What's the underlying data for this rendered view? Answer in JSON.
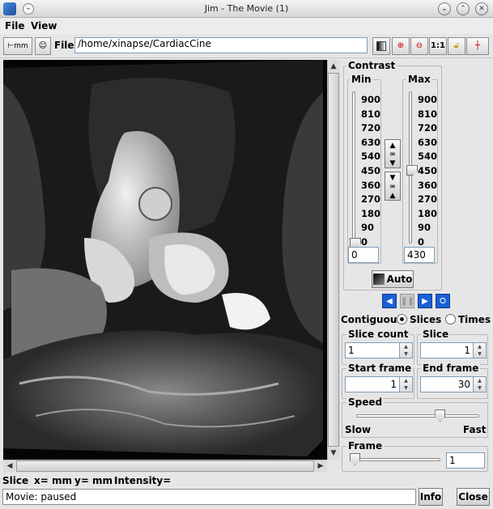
{
  "window": {
    "title": "Jim - The Movie (1)"
  },
  "menu": {
    "file": "File",
    "view": "View"
  },
  "toolbar": {
    "units_label": "mm",
    "file_label": "File:",
    "file_path": "/home/xinapse/CardiacCine",
    "zoom_1to1": "1:1"
  },
  "contrast": {
    "title": "Contrast",
    "min_label": "Min",
    "max_label": "Max",
    "ticks": [
      "900",
      "810",
      "720",
      "630",
      "540",
      "450",
      "360",
      "270",
      "180",
      "90",
      "0"
    ],
    "min_value": "0",
    "max_value": "430",
    "min_slider_fraction": 0.0,
    "max_slider_fraction": 0.478,
    "auto_label": "Auto"
  },
  "movie": {
    "contiguous_label": "Contiguous",
    "slices_label": "Slices",
    "times_label": "Times",
    "selected_mode": "Slices",
    "slice_count_label": "Slice count",
    "slice_count_value": "1",
    "slice_label": "Slice",
    "slice_value": "1",
    "start_frame_label": "Start frame",
    "start_frame_value": "1",
    "end_frame_label": "End frame",
    "end_frame_value": "30",
    "speed_label": "Speed",
    "slow_label": "Slow",
    "fast_label": "Fast",
    "speed_fraction": 0.7,
    "frame_label": "Frame",
    "frame_value": "1",
    "frame_fraction": 0.0
  },
  "status": {
    "slice_label": "Slice",
    "x_label": "x= mm",
    "y_label": "y= mm",
    "intensity_label": "Intensity=",
    "message": "Movie: paused",
    "info_button": "Info",
    "close_button": "Close"
  }
}
